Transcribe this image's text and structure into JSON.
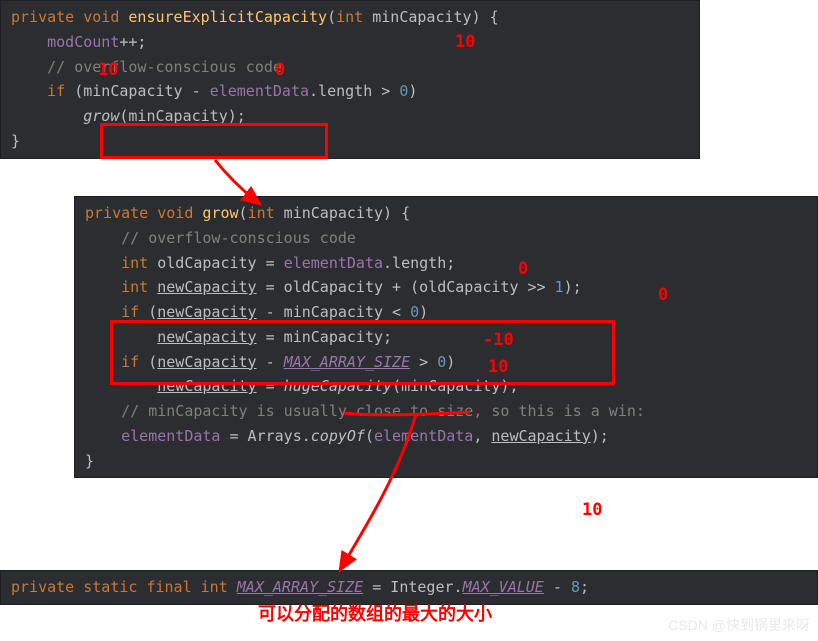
{
  "panel1": {
    "line1": {
      "kw1": "private",
      "kw2": "void",
      "method": "ensureExplicitCapacity",
      "sig": "(",
      "type": "int",
      "param": " minCapacity) {"
    },
    "line2": {
      "field": "modCount",
      "rest": "++;"
    },
    "line3": {
      "comment": "// overflow-conscious code"
    },
    "line4": {
      "kw": "if",
      "open": " (minCapacity - ",
      "field": "elementData",
      "mid": ".length > ",
      "num": "0",
      "close": ")"
    },
    "line5": {
      "call": "grow",
      "args": "(minCapacity);"
    },
    "line6": {
      "close": "}"
    }
  },
  "panel2": {
    "line1": {
      "kw1": "private",
      "kw2": "void",
      "method": "grow",
      "sig": "(",
      "type": "int",
      "param": " minCapacity) {"
    },
    "line2": {
      "comment": "// overflow-conscious code"
    },
    "line3": {
      "type": "int",
      "var": " oldCapacity = ",
      "field": "elementData",
      "rest": ".length;"
    },
    "line4": {
      "type": "int",
      "var1": " ",
      "ulvar": "newCapacity",
      "rest1": " = oldCapacity + (oldCapacity >> ",
      "num": "1",
      "rest2": ");"
    },
    "line5": {
      "kw": "if",
      "open": " (",
      "ulvar": "newCapacity",
      "mid": " - minCapacity < ",
      "num": "0",
      "close": ")"
    },
    "line6": {
      "ulvar": "newCapacity",
      "rest": " = minCapacity;"
    },
    "line7": {
      "kw": "if",
      "open": " (",
      "ulvar": "newCapacity",
      "mid": " - ",
      "const": "MAX_ARRAY_SIZE",
      "mid2": " > ",
      "num": "0",
      "close": ")"
    },
    "line8": {
      "ulvar": "newCapacity",
      "eq": " = ",
      "call": "hugeCapacity",
      "args": "(minCapacity);"
    },
    "line9": {
      "comment": "// minCapacity is usually close to size, so this is a win:"
    },
    "line10": {
      "field": "elementData",
      "eq": " = Arrays.",
      "call": "copyOf",
      "open": "(",
      "field2": "elementData",
      "mid": ", ",
      "ulvar": "newCapacity",
      "close": ");"
    },
    "line11": {
      "close": "}"
    }
  },
  "panel3": {
    "line1": {
      "kw1": "private",
      "kw2": "static",
      "kw3": "final",
      "type": "int",
      "const": "MAX_ARRAY_SIZE",
      "eq": " = Integer.",
      "val": "MAX_VALUE",
      "minus": " - ",
      "num": "8",
      "semi": ";"
    }
  },
  "annotations": {
    "a1": "10",
    "a2": "0",
    "a3": "10",
    "a4": "0",
    "a5": "0",
    "a6": "-10",
    "a7": "10",
    "a8": "10",
    "bottom": "可以分配的数组的最大的大小"
  },
  "watermark": "CSDN @快到锅里来呀"
}
